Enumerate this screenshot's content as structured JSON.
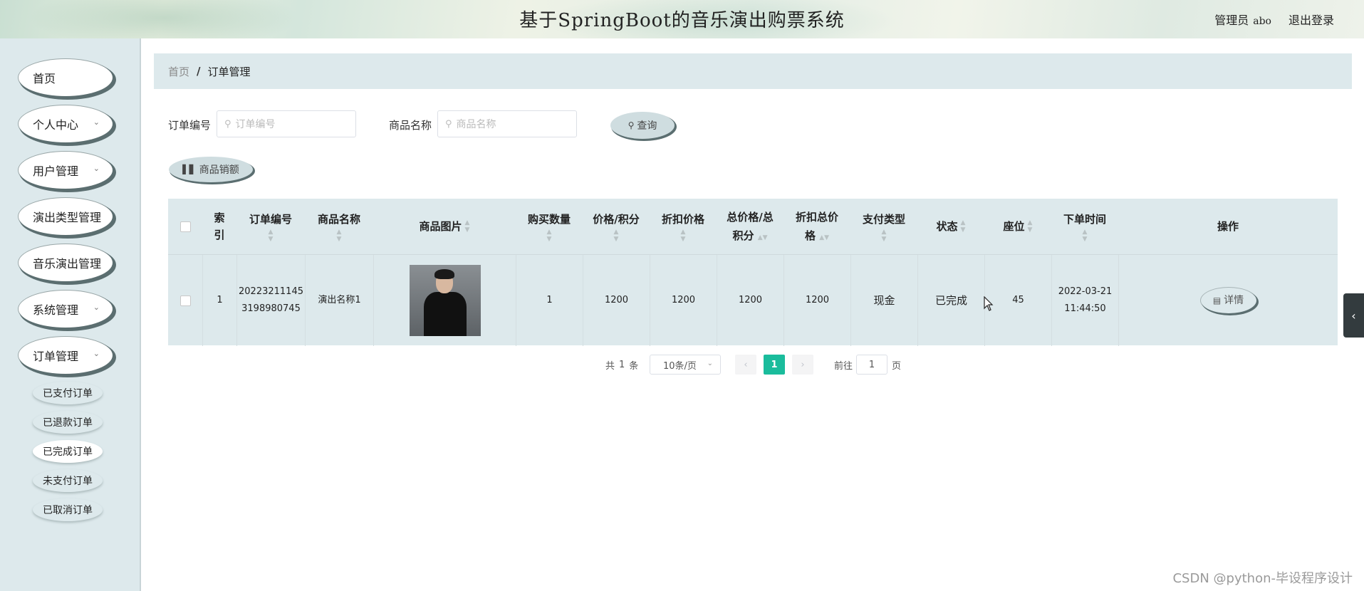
{
  "header": {
    "title": "基于SpringBoot的音乐演出购票系统",
    "role": "管理员",
    "username": "abo",
    "logout": "退出登录"
  },
  "sidebar": {
    "items": [
      {
        "label": "首页",
        "has_arrow": false
      },
      {
        "label": "个人中心",
        "has_arrow": true
      },
      {
        "label": "用户管理",
        "has_arrow": true
      },
      {
        "label": "演出类型管理",
        "has_arrow": false
      },
      {
        "label": "音乐演出管理",
        "has_arrow": false
      },
      {
        "label": "系统管理",
        "has_arrow": true
      },
      {
        "label": "订单管理",
        "has_arrow": true
      }
    ],
    "sub_items": [
      {
        "label": "已支付订单",
        "active": false
      },
      {
        "label": "已退款订单",
        "active": false
      },
      {
        "label": "已完成订单",
        "active": true
      },
      {
        "label": "未支付订单",
        "active": false
      },
      {
        "label": "已取消订单",
        "active": false
      }
    ]
  },
  "breadcrumb": {
    "home": "首页",
    "separator": "/",
    "current": "订单管理"
  },
  "search": {
    "order_no_label": "订单编号",
    "order_no_placeholder": "订单编号",
    "product_label": "商品名称",
    "product_placeholder": "商品名称",
    "query_button": "查询",
    "sales_button": "商品销额"
  },
  "table": {
    "headers": {
      "index": "索引",
      "order_no": "订单编号",
      "product_name": "商品名称",
      "product_image": "商品图片",
      "quantity": "购买数量",
      "price_points": "价格/积分",
      "discount_price": "折扣价格",
      "total_price_points_a": "总价格/总",
      "total_price_points_b": "积分",
      "discount_total_a": "折扣总价",
      "discount_total_b": "格",
      "pay_type": "支付类型",
      "status": "状态",
      "seat": "座位",
      "order_time": "下单时间",
      "actions": "操作"
    },
    "rows": [
      {
        "index": "1",
        "order_no_a": "20223211145",
        "order_no_b": "3198980745",
        "product_name": "演出名称1",
        "quantity": "1",
        "price_points": "1200",
        "discount_price": "1200",
        "total_price_points": "1200",
        "discount_total": "1200",
        "pay_type": "现金",
        "status": "已完成",
        "seat": "45",
        "order_date": "2022-03-21",
        "order_clock": "11:44:50",
        "detail_button": "详情"
      }
    ]
  },
  "pagination": {
    "total_prefix": "共",
    "total": "1",
    "total_suffix": "条",
    "page_size": "10条/页",
    "current_page": "1",
    "goto_prefix": "前往",
    "goto_value": "1",
    "goto_suffix": "页"
  },
  "watermark": "CSDN @python-毕设程序设计"
}
